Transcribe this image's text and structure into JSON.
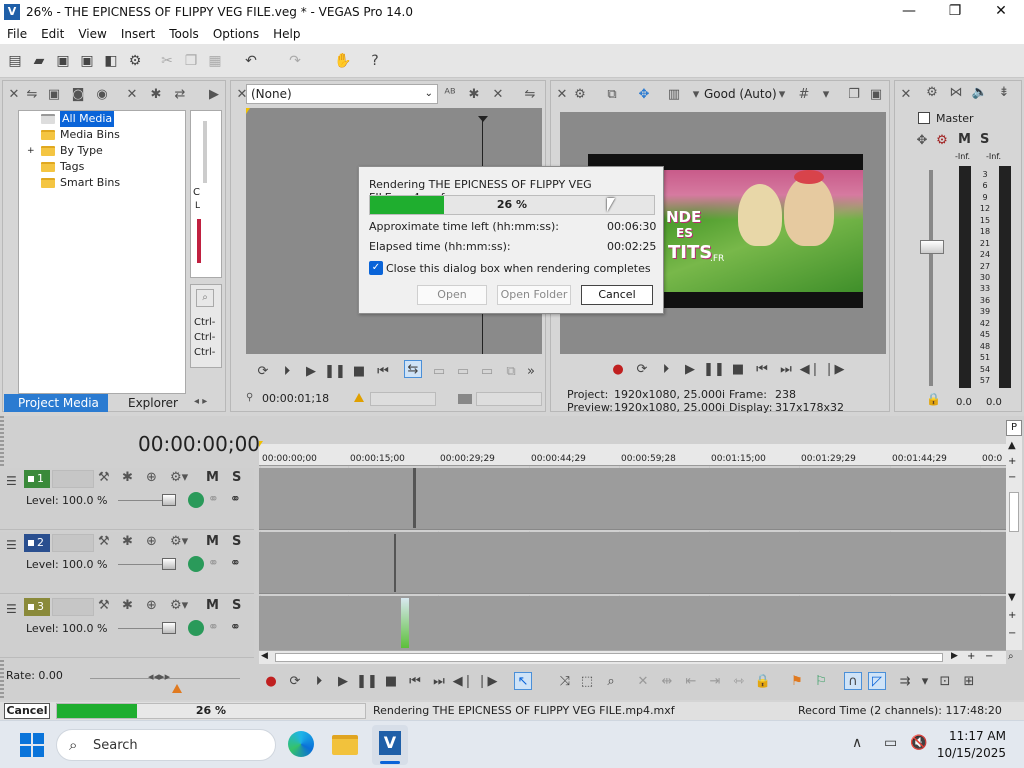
{
  "window": {
    "title": "26% - THE EPICNESS OF FLIPPY VEG FILE.veg * - VEGAS Pro 14.0",
    "minimize": "—",
    "maximize": "❐",
    "close": "✕"
  },
  "menu": [
    "File",
    "Edit",
    "View",
    "Insert",
    "Tools",
    "Options",
    "Help"
  ],
  "media": {
    "tree": [
      "All Media",
      "Media Bins",
      "By Type",
      "Tags",
      "Smart Bins"
    ],
    "tree_expander": "+",
    "peek_text": [
      "C",
      "L"
    ],
    "ctrl_labels": [
      "Ctrl-",
      "Ctrl-",
      "Ctrl-"
    ],
    "tabs": [
      "Project Media",
      "Explorer"
    ]
  },
  "trimmer": {
    "preset": "(None)",
    "timecode": "00:00:01;18"
  },
  "preview": {
    "quality": "Good (Auto)",
    "project_label": "Project:",
    "project_value": "1920x1080, 25.000i",
    "preview_label": "Preview:",
    "preview_value": "1920x1080, 25.000i",
    "frame_label": "Frame:",
    "frame_value": "238",
    "display_label": "Display:",
    "display_value": "317x178x32"
  },
  "mixer": {
    "title": "Master",
    "m_label": "M",
    "s_label": "S",
    "peak_left": "-Inf.",
    "peak_right": "-Inf.",
    "db_scale": [
      "3",
      "6",
      "9",
      "12",
      "15",
      "18",
      "21",
      "24",
      "27",
      "30",
      "33",
      "36",
      "39",
      "42",
      "45",
      "48",
      "51",
      "54",
      "57"
    ],
    "bottom_left": "0.0",
    "bottom_right": "0.0"
  },
  "render_dialog": {
    "title": "Rendering THE EPICNESS OF FLIPPY VEG FILE.mp4.mxf",
    "progress_label": "26 %",
    "progress": 0.26,
    "time_left_label": "Approximate time left (hh:mm:ss):",
    "time_left": "00:06:30",
    "elapsed_label": "Elapsed time (hh:mm:ss):",
    "elapsed": "00:02:25",
    "close_checkbox_label": "Close this dialog box when rendering completes",
    "close_checkbox_checked": true,
    "open_button": "Open",
    "open_folder_button": "Open Folder",
    "cancel_button": "Cancel"
  },
  "video_overlay": {
    "line1": "NDE",
    "line2": "ES",
    "line3": "TITS",
    "suffix": ".FR"
  },
  "timeline": {
    "cursor_time": "00:00:00;00",
    "ruler": [
      "00:00:00;00",
      "00:00:15;00",
      "00:00:29;29",
      "00:00:44;29",
      "00:00:59;28",
      "00:01:15;00",
      "00:01:29;29",
      "00:01:44;29",
      "00:0"
    ],
    "tracks": [
      {
        "number": "1",
        "level_label": "Level:",
        "level": "100.0 %",
        "m": "M",
        "s": "S",
        "color": "#3a8a3a"
      },
      {
        "number": "2",
        "level_label": "Level:",
        "level": "100.0 %",
        "m": "M",
        "s": "S",
        "color": "#2a4f8f"
      },
      {
        "number": "3",
        "level_label": "Level:",
        "level": "100.0 %",
        "m": "M",
        "s": "S",
        "color": "#8a8a3a"
      }
    ],
    "rate_label": "Rate: 0.00"
  },
  "status": {
    "cancel_button": "Cancel",
    "progress_label": "26 %",
    "progress": 0.26,
    "message": "Rendering THE EPICNESS OF FLIPPY VEG FILE.mp4.mxf",
    "record_time": "Record Time (2 channels): 117:48:20"
  },
  "taskbar": {
    "search_placeholder": "Search",
    "time": "11:17 AM",
    "date": "10/15/2025"
  },
  "colors": {
    "progress_green": "#1fae2f",
    "accent_blue": "#0a64d8",
    "pane": "#d2d2d2"
  }
}
